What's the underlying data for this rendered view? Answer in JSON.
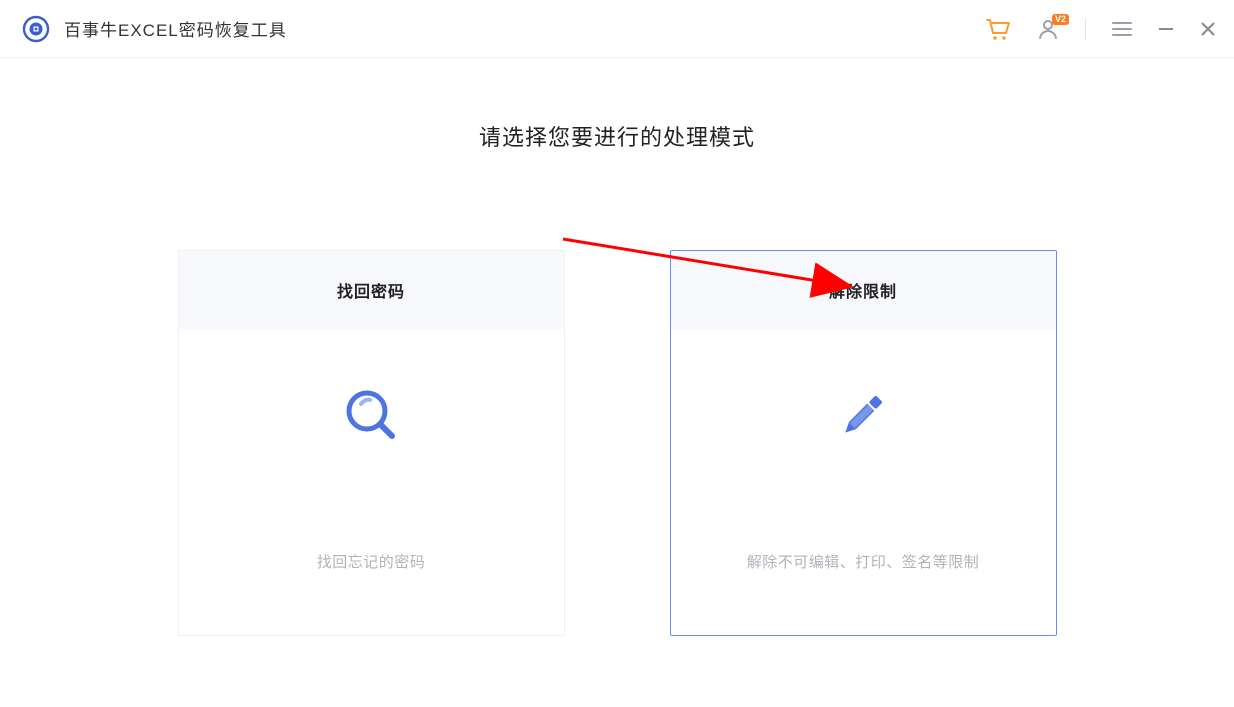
{
  "app": {
    "title": "百事牛EXCEL密码恢复工具"
  },
  "titlebar": {
    "cart_icon": "cart-icon",
    "user_icon": "user-icon",
    "user_badge": "V2",
    "menu_icon": "menu-icon",
    "minimize_icon": "minimize-icon",
    "close_icon": "close-icon"
  },
  "main": {
    "heading": "请选择您要进行的处理模式"
  },
  "cards": [
    {
      "title": "找回密码",
      "desc": "找回忘记的密码",
      "icon": "magnifier-icon",
      "selected": false
    },
    {
      "title": "解除限制",
      "desc": "解除不可编辑、打印、签名等限制",
      "icon": "pencil-icon",
      "selected": true
    }
  ]
}
